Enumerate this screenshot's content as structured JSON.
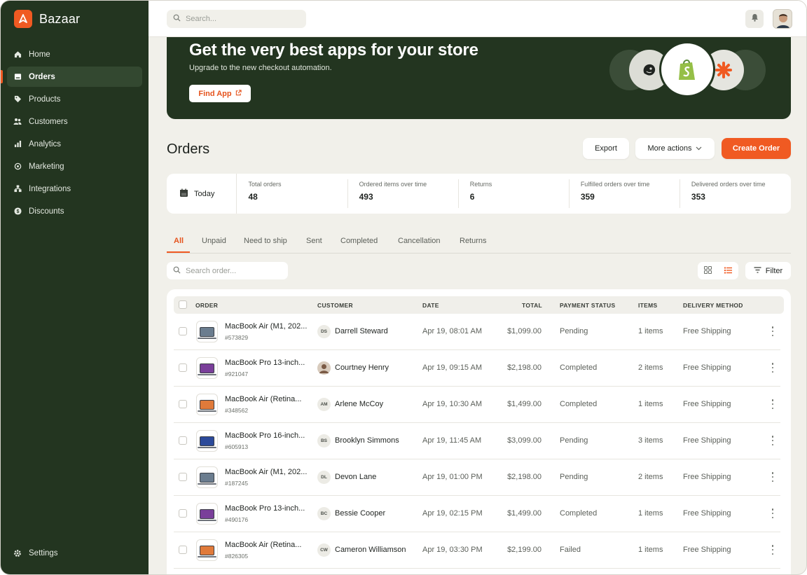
{
  "brand": {
    "name": "Bazaar",
    "accent": "#f05a22",
    "sidebar_bg": "#233520"
  },
  "sidebar": {
    "items": [
      {
        "label": "Home",
        "icon": "home-icon",
        "active": false
      },
      {
        "label": "Orders",
        "icon": "orders-icon",
        "active": true
      },
      {
        "label": "Products",
        "icon": "tag-icon",
        "active": false
      },
      {
        "label": "Customers",
        "icon": "users-icon",
        "active": false
      },
      {
        "label": "Analytics",
        "icon": "bar-chart-icon",
        "active": false
      },
      {
        "label": "Marketing",
        "icon": "target-icon",
        "active": false
      },
      {
        "label": "Integrations",
        "icon": "integrations-icon",
        "active": false
      },
      {
        "label": "Discounts",
        "icon": "discount-icon",
        "active": false
      }
    ],
    "settings_label": "Settings"
  },
  "topbar": {
    "search_placeholder": "Search..."
  },
  "banner": {
    "title": "Get the very best apps for your store",
    "subtitle": "Upgrade to the new checkout automation.",
    "button_label": "Find App"
  },
  "page": {
    "title": "Orders",
    "export_label": "Export",
    "more_actions_label": "More actions",
    "create_label": "Create Order"
  },
  "stats": {
    "period": "Today",
    "items": [
      {
        "label": "Total orders",
        "value": "48"
      },
      {
        "label": "Ordered items over time",
        "value": "493"
      },
      {
        "label": "Returns",
        "value": "6"
      },
      {
        "label": "Fulfilled orders over time",
        "value": "359"
      },
      {
        "label": "Delivered orders over time",
        "value": "353"
      }
    ]
  },
  "tabs": [
    "All",
    "Unpaid",
    "Need to ship",
    "Sent",
    "Completed",
    "Cancellation",
    "Returns"
  ],
  "order_search_placeholder": "Search order...",
  "filter_label": "Filter",
  "table": {
    "headers": [
      "ORDER",
      "CUSTOMER",
      "DATE",
      "TOTAL",
      "PAYMENT STATUS",
      "ITEMS",
      "DELIVERY METHOD"
    ],
    "rows": [
      {
        "product": "MacBook Air (M1, 202...",
        "id": "#573829",
        "thumb": "#6b7d8f",
        "initials": "DS",
        "customer": "Darrell Steward",
        "date": "Apr 19, 08:01 AM",
        "total": "$1,099.00",
        "status": "Pending",
        "items": "1 items",
        "delivery": "Free Shipping"
      },
      {
        "product": "MacBook Pro 13-inch...",
        "id": "#921047",
        "thumb": "#7a3f9a",
        "initials": "",
        "customer": "Courtney Henry",
        "date": "Apr 19, 09:15 AM",
        "total": "$2,198.00",
        "status": "Completed",
        "items": "2 items",
        "delivery": "Free Shipping"
      },
      {
        "product": "MacBook Air (Retina...",
        "id": "#348562",
        "thumb": "#e07a3a",
        "initials": "AM",
        "customer": "Arlene McCoy",
        "date": "Apr 19, 10:30 AM",
        "total": "$1,499.00",
        "status": "Completed",
        "items": "1 items",
        "delivery": "Free Shipping"
      },
      {
        "product": "MacBook Pro 16-inch...",
        "id": "#605913",
        "thumb": "#2c4a9a",
        "initials": "BS",
        "customer": "Brooklyn Simmons",
        "date": "Apr 19, 11:45 AM",
        "total": "$3,099.00",
        "status": "Pending",
        "items": "3 items",
        "delivery": "Free Shipping"
      },
      {
        "product": "MacBook Air (M1, 202...",
        "id": "#187245",
        "thumb": "#6b7d8f",
        "initials": "DL",
        "customer": "Devon Lane",
        "date": "Apr 19, 01:00 PM",
        "total": "$2,198.00",
        "status": "Pending",
        "items": "2 items",
        "delivery": "Free Shipping"
      },
      {
        "product": "MacBook Pro 13-inch...",
        "id": "#490176",
        "thumb": "#7a3f9a",
        "initials": "BC",
        "customer": "Bessie Cooper",
        "date": "Apr 19, 02:15 PM",
        "total": "$1,499.00",
        "status": "Completed",
        "items": "1 items",
        "delivery": "Free Shipping"
      },
      {
        "product": "MacBook Air (Retina...",
        "id": "#826305",
        "thumb": "#e07a3a",
        "initials": "CW",
        "customer": "Cameron Williamson",
        "date": "Apr 19, 03:30 PM",
        "total": "$2,199.00",
        "status": "Failed",
        "items": "1 items",
        "delivery": "Free Shipping"
      }
    ]
  }
}
